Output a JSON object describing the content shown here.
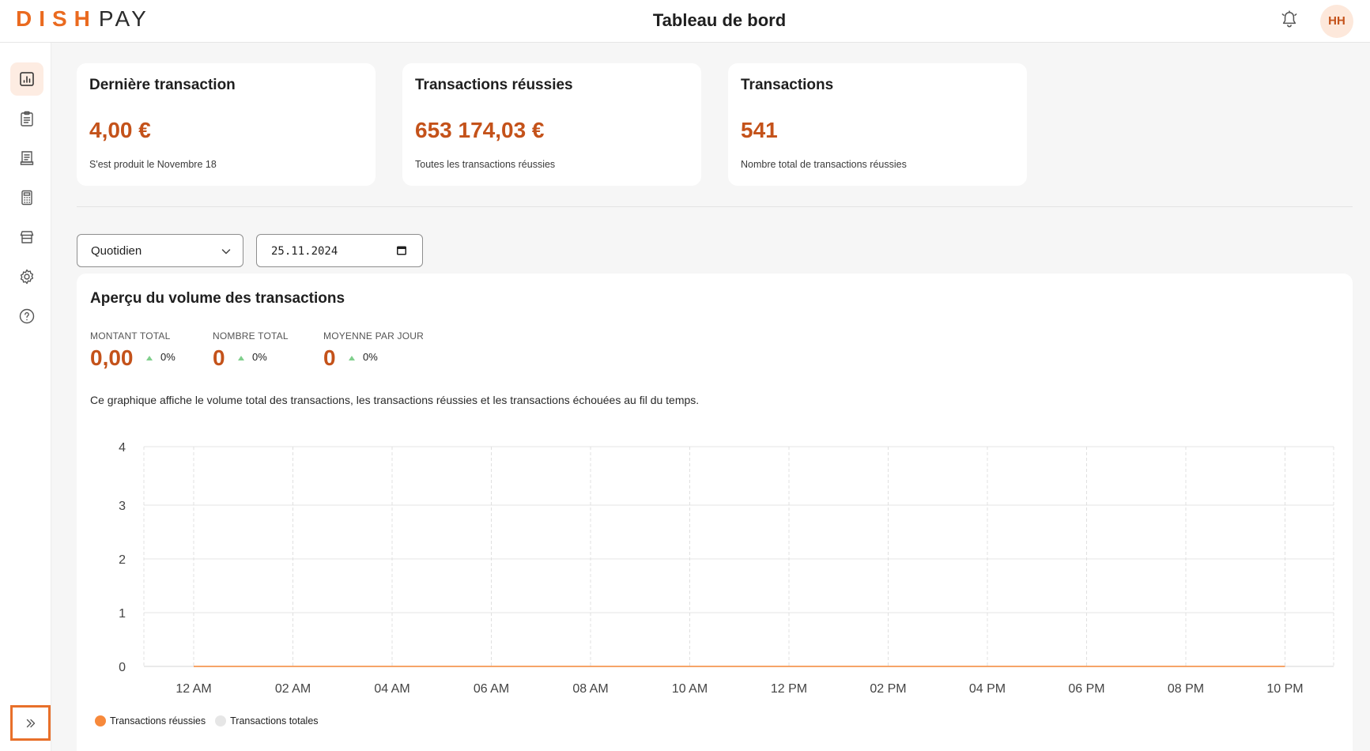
{
  "header": {
    "logo_brand": "DISH",
    "logo_product": "PAY",
    "title": "Tableau de bord",
    "avatar_initials": "HH",
    "notification_icon": "bell-icon"
  },
  "sidebar": {
    "items": [
      {
        "name": "dashboard",
        "icon": "chart-icon",
        "active": true
      },
      {
        "name": "transactions",
        "icon": "clipboard-icon",
        "active": false
      },
      {
        "name": "reports",
        "icon": "receipt-icon",
        "active": false
      },
      {
        "name": "terminals",
        "icon": "calculator-icon",
        "active": false
      },
      {
        "name": "stores",
        "icon": "store-icon",
        "active": false
      },
      {
        "name": "settings",
        "icon": "gear-icon",
        "active": false
      },
      {
        "name": "help",
        "icon": "help-icon",
        "active": false
      }
    ],
    "expand_icon": "double-chevron-right-icon"
  },
  "cards": [
    {
      "title": "Dernière transaction",
      "value": "4,00 €",
      "subtitle": "S'est produit le Novembre 18"
    },
    {
      "title": "Transactions réussies",
      "value": "653 174,03 €",
      "subtitle": "Toutes les transactions réussies"
    },
    {
      "title": "Transactions",
      "value": "541",
      "subtitle": "Nombre total de transactions réussies"
    }
  ],
  "filters": {
    "period": "Quotidien",
    "date": "25.11.2024"
  },
  "overview": {
    "title": "Aperçu du volume des transactions",
    "metrics": [
      {
        "label": "MONTANT TOTAL",
        "value": "0,00",
        "change": "0%"
      },
      {
        "label": "NOMBRE TOTAL",
        "value": "0",
        "change": "0%"
      },
      {
        "label": "MOYENNE PAR JOUR",
        "value": "0",
        "change": "0%"
      }
    ],
    "description": "Ce graphique affiche le volume total des transactions, les transactions réussies et les transactions échouées au fil du temps."
  },
  "chart_data": {
    "type": "line",
    "x": [
      "12 AM",
      "02 AM",
      "04 AM",
      "06 AM",
      "08 AM",
      "10 AM",
      "12 PM",
      "02 PM",
      "04 PM",
      "06 PM",
      "08 PM",
      "10 PM"
    ],
    "yticks": [
      0,
      1,
      2,
      3,
      4
    ],
    "ylim": [
      0,
      4
    ],
    "grid": true,
    "legend_position": "bottom-left",
    "series": [
      {
        "name": "Transactions réussies",
        "color": "#f7893b",
        "values": [
          0,
          0,
          0,
          0,
          0,
          0,
          0,
          0,
          0,
          0,
          0,
          0
        ]
      },
      {
        "name": "Transactions totales",
        "color": "#e6e6e6",
        "values": [
          0,
          0,
          0,
          0,
          0,
          0,
          0,
          0,
          0,
          0,
          0,
          0
        ]
      }
    ]
  },
  "colors": {
    "accent": "#ea6a1f",
    "value_text": "#c4521a",
    "up_arrow": "#7fcf8c"
  }
}
